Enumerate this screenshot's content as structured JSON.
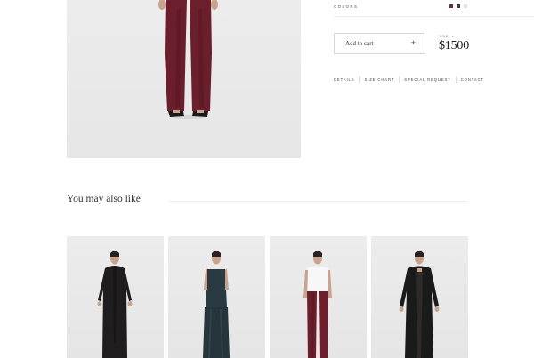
{
  "product": {
    "colors_label": "COLORS",
    "swatch_colors": [
      "#6b2b33",
      "#3a3a44",
      "#f3d8dc"
    ],
    "add_to_cart_label": "Add to cart",
    "add_to_cart_icon": "+",
    "currency_label": "SGD",
    "currency_icon": "chevron-down-icon",
    "price": "$1500",
    "tabs": [
      "DETAILS",
      "SIZE CHART",
      "SPECIAL REQUEST",
      "CONTACT"
    ]
  },
  "related": {
    "title": "You may also like",
    "items": [
      {
        "name": "black-dress",
        "color": "#1f1d1d"
      },
      {
        "name": "teal-two-piece",
        "color": "#2a3a42"
      },
      {
        "name": "white-top-burgundy-pants",
        "color": "#6b1e2b"
      },
      {
        "name": "black-open-coat",
        "color": "#1b1a1a"
      }
    ]
  }
}
